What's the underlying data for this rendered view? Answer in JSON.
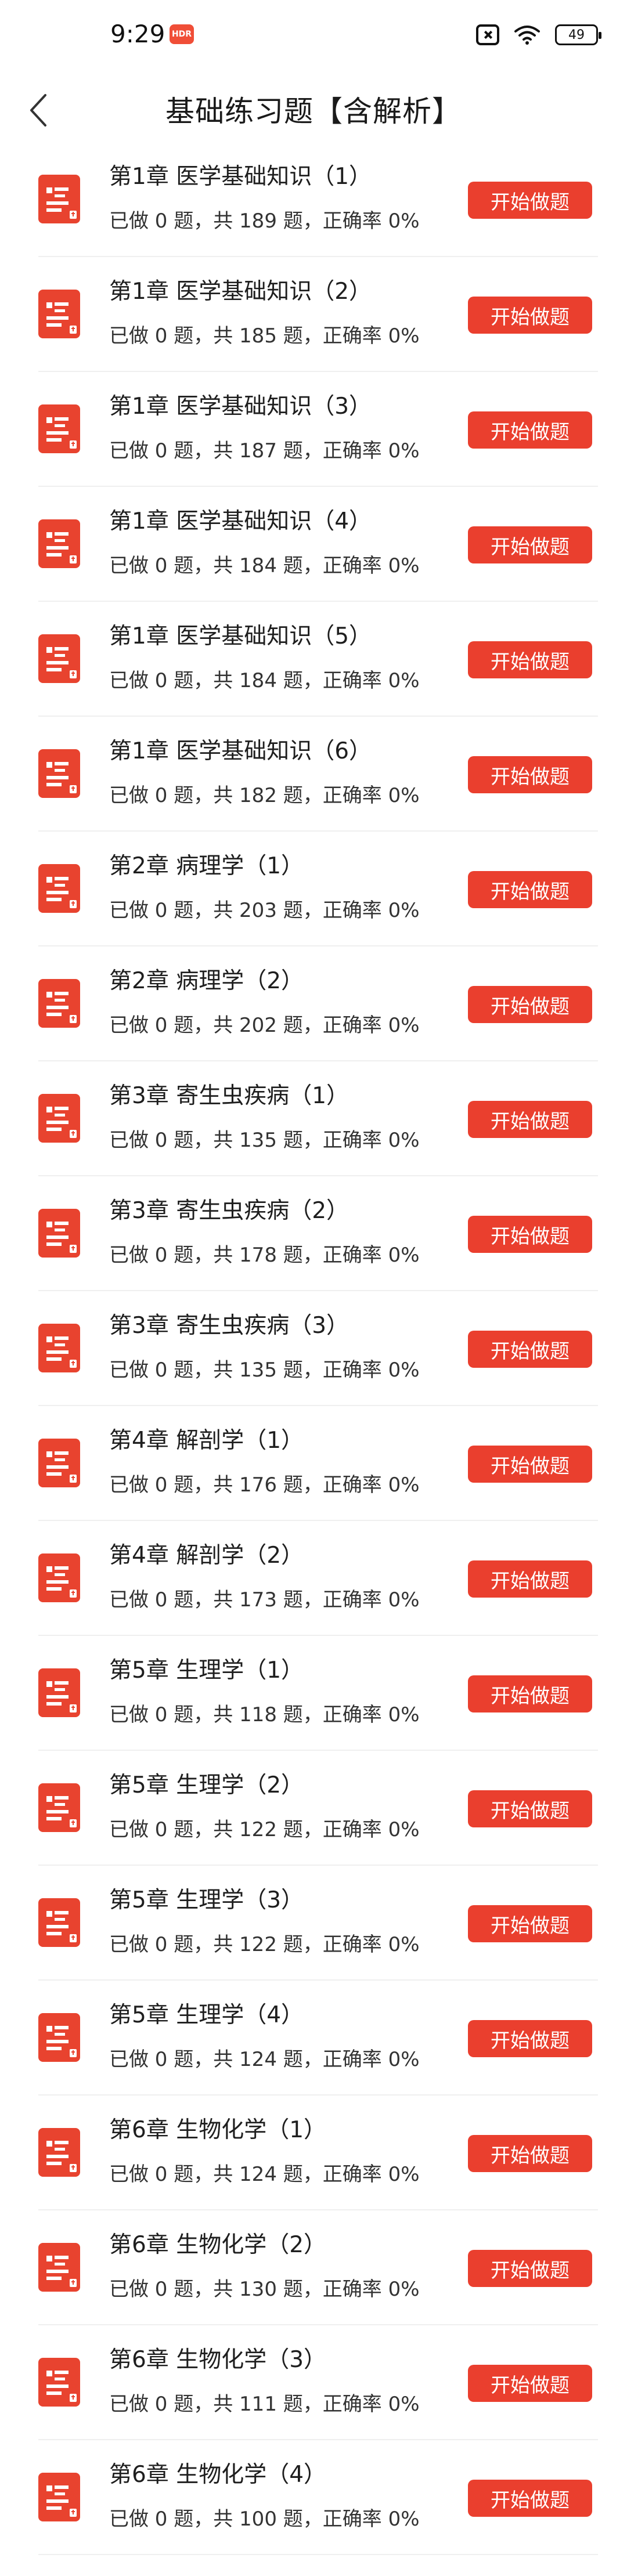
{
  "status_bar": {
    "time": "9:29",
    "badge": "HDR",
    "battery": "49"
  },
  "header": {
    "title": "基础练习题【含解析】"
  },
  "colors": {
    "accent": "#ea3f2e",
    "icon_bg": "#e8432f"
  },
  "icons": {
    "back": "chevron-left-icon",
    "row": "document-list-icon"
  },
  "items": [
    {
      "title": "第1章 医学基础知识（1）",
      "subtitle": "已做 0 题，共 189 题，正确率 0%",
      "button": "开始做题"
    },
    {
      "title": "第1章 医学基础知识（2）",
      "subtitle": "已做 0 题，共 185 题，正确率 0%",
      "button": "开始做题"
    },
    {
      "title": "第1章 医学基础知识（3）",
      "subtitle": "已做 0 题，共 187 题，正确率 0%",
      "button": "开始做题"
    },
    {
      "title": "第1章 医学基础知识（4）",
      "subtitle": "已做 0 题，共 184 题，正确率 0%",
      "button": "开始做题"
    },
    {
      "title": "第1章 医学基础知识（5）",
      "subtitle": "已做 0 题，共 184 题，正确率 0%",
      "button": "开始做题"
    },
    {
      "title": "第1章 医学基础知识（6）",
      "subtitle": "已做 0 题，共 182 题，正确率 0%",
      "button": "开始做题"
    },
    {
      "title": "第2章 病理学（1）",
      "subtitle": "已做 0 题，共 203 题，正确率 0%",
      "button": "开始做题"
    },
    {
      "title": "第2章 病理学（2）",
      "subtitle": "已做 0 题，共 202 题，正确率 0%",
      "button": "开始做题"
    },
    {
      "title": "第3章 寄生虫疾病（1）",
      "subtitle": "已做 0 题，共 135 题，正确率 0%",
      "button": "开始做题"
    },
    {
      "title": "第3章 寄生虫疾病（2）",
      "subtitle": "已做 0 题，共 178 题，正确率 0%",
      "button": "开始做题"
    },
    {
      "title": "第3章 寄生虫疾病（3）",
      "subtitle": "已做 0 题，共 135 题，正确率 0%",
      "button": "开始做题"
    },
    {
      "title": "第4章 解剖学（1）",
      "subtitle": "已做 0 题，共 176 题，正确率 0%",
      "button": "开始做题"
    },
    {
      "title": "第4章 解剖学（2）",
      "subtitle": "已做 0 题，共 173 题，正确率 0%",
      "button": "开始做题"
    },
    {
      "title": "第5章 生理学（1）",
      "subtitle": "已做 0 题，共 118 题，正确率 0%",
      "button": "开始做题"
    },
    {
      "title": "第5章 生理学（2）",
      "subtitle": "已做 0 题，共 122 题，正确率 0%",
      "button": "开始做题"
    },
    {
      "title": "第5章 生理学（3）",
      "subtitle": "已做 0 题，共 122 题，正确率 0%",
      "button": "开始做题"
    },
    {
      "title": "第5章 生理学（4）",
      "subtitle": "已做 0 题，共 124 题，正确率 0%",
      "button": "开始做题"
    },
    {
      "title": "第6章 生物化学（1）",
      "subtitle": "已做 0 题，共 124 题，正确率 0%",
      "button": "开始做题"
    },
    {
      "title": "第6章 生物化学（2）",
      "subtitle": "已做 0 题，共 130 题，正确率 0%",
      "button": "开始做题"
    },
    {
      "title": "第6章 生物化学（3）",
      "subtitle": "已做 0 题，共 111 题，正确率 0%",
      "button": "开始做题"
    },
    {
      "title": "第6章 生物化学（4）",
      "subtitle": "已做 0 题，共 100 题，正确率 0%",
      "button": "开始做题"
    }
  ]
}
